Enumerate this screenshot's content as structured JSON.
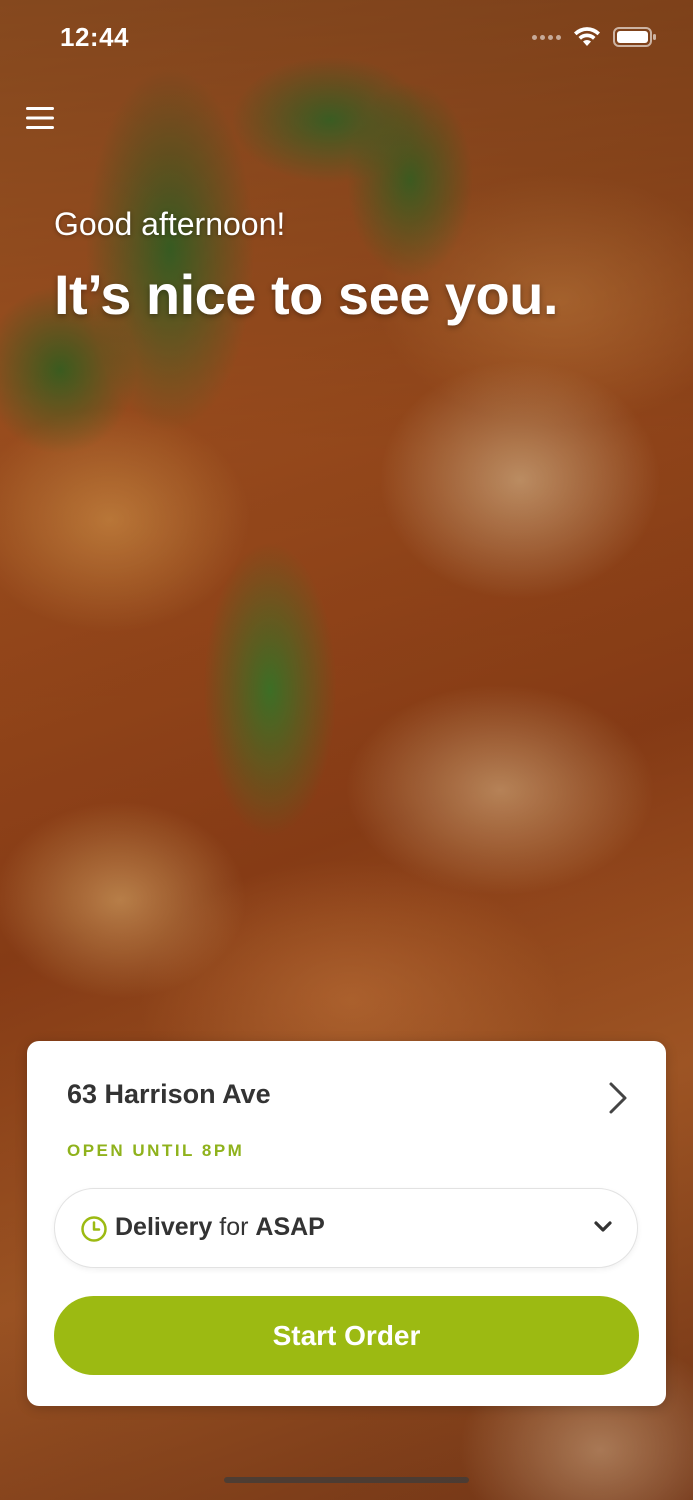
{
  "status_bar": {
    "time": "12:44",
    "icons": [
      "signal-icon",
      "wifi-icon",
      "battery-icon"
    ]
  },
  "menu": {
    "icon": "hamburger-menu-icon"
  },
  "hero": {
    "greeting": "Good afternoon!",
    "headline": "It’s nice to see you."
  },
  "location_card": {
    "location_name": "63 Harrison Ave",
    "open_status": "OPEN UNTIL 8PM",
    "order_mode": {
      "mode": "Delivery",
      "connector": "for",
      "time": "ASAP"
    },
    "start_button_label": "Start Order"
  },
  "colors": {
    "accent": "#9cba12",
    "open_status": "#8fb21c",
    "card_background": "#ffffff",
    "text_dark": "#333333"
  }
}
